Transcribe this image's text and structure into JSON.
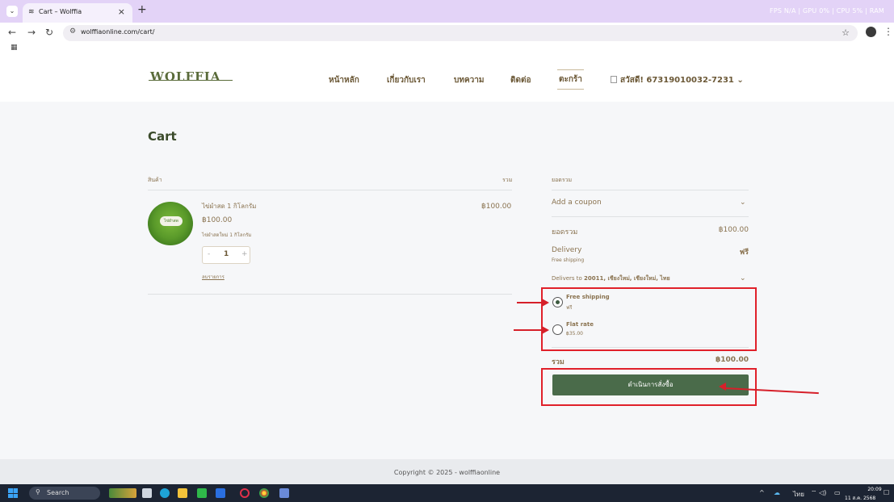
{
  "browser": {
    "tab_title": "Cart – Wolffia",
    "tab_favicon": "wolffia-favicon",
    "tab_close": "×",
    "new_tab": "+",
    "perf_text": "FPS N/A | GPU 0% | CPU 5% | RAM",
    "url": "wolffiaonline.com/cart/"
  },
  "site": {
    "logo": "WOLFFIA",
    "nav": [
      "หน้าหลัก",
      "เกี่ยวกับเรา",
      "บทความ",
      "ติดต่อ",
      "ตะกร้า"
    ],
    "user_label": "สวัสดี! 67319010032-7231 ⌄"
  },
  "cart": {
    "title": "Cart",
    "col_product": "สินค้า",
    "col_total": "รวม",
    "item": {
      "name": "ไข่ผำสด 1 กิโลกรัม",
      "price": "฿100.00",
      "desc": "ไข่ผำสดใหม่ 1 กิโลกรัม",
      "qty": "1",
      "remove": "ลบรายการ",
      "line_total": "฿100.00",
      "img_label": "ไข่ผำสด"
    }
  },
  "totals": {
    "header": "ยอดรวม",
    "coupon": "Add a coupon",
    "subtotal_label": "ยอดรวม",
    "subtotal_value": "฿100.00",
    "delivery_label": "Delivery",
    "delivery_sub": "Free shipping",
    "delivery_value": "ฟรี",
    "delivers_to_prefix": "Delivers to ",
    "delivers_to_addr": "20011, เชียงใหม่, เชียงใหม่, ไทย",
    "options": [
      {
        "name": "Free shipping",
        "sub": "ฟรี",
        "selected": true
      },
      {
        "name": "Flat rate",
        "sub": "฿35.00",
        "selected": false
      }
    ],
    "total_label": "รวม",
    "total_value": "฿100.00",
    "checkout": "ดำเนินการสั่งซื้อ"
  },
  "footer": {
    "copyright": "Copyright © 2025 - wolffiaonline"
  },
  "taskbar": {
    "search": "Search",
    "tray_lang": "ไทย",
    "time": "20:09",
    "date": "11 ส.ค. 2568"
  },
  "colors": {
    "accent_green": "#4a6b4a",
    "text_brown": "#8a7350",
    "annotation_red": "#e0202a"
  }
}
